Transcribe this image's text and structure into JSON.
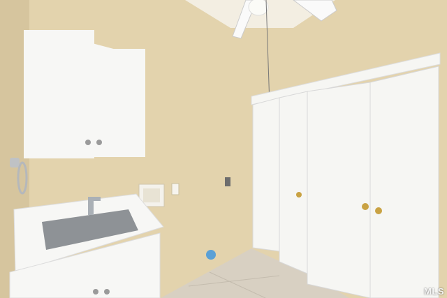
{
  "photo": {
    "watermark": "MLS",
    "colors": {
      "wall": "#e3d3ad",
      "wall_shadow": "#d6c59e",
      "ceiling": "#f3eee2",
      "cabinet": "#f7f7f5",
      "door": "#f6f6f3",
      "floor": "#d8d0c2",
      "sink_steel": "#8e9296",
      "knob_brass": "#c9a243"
    }
  }
}
